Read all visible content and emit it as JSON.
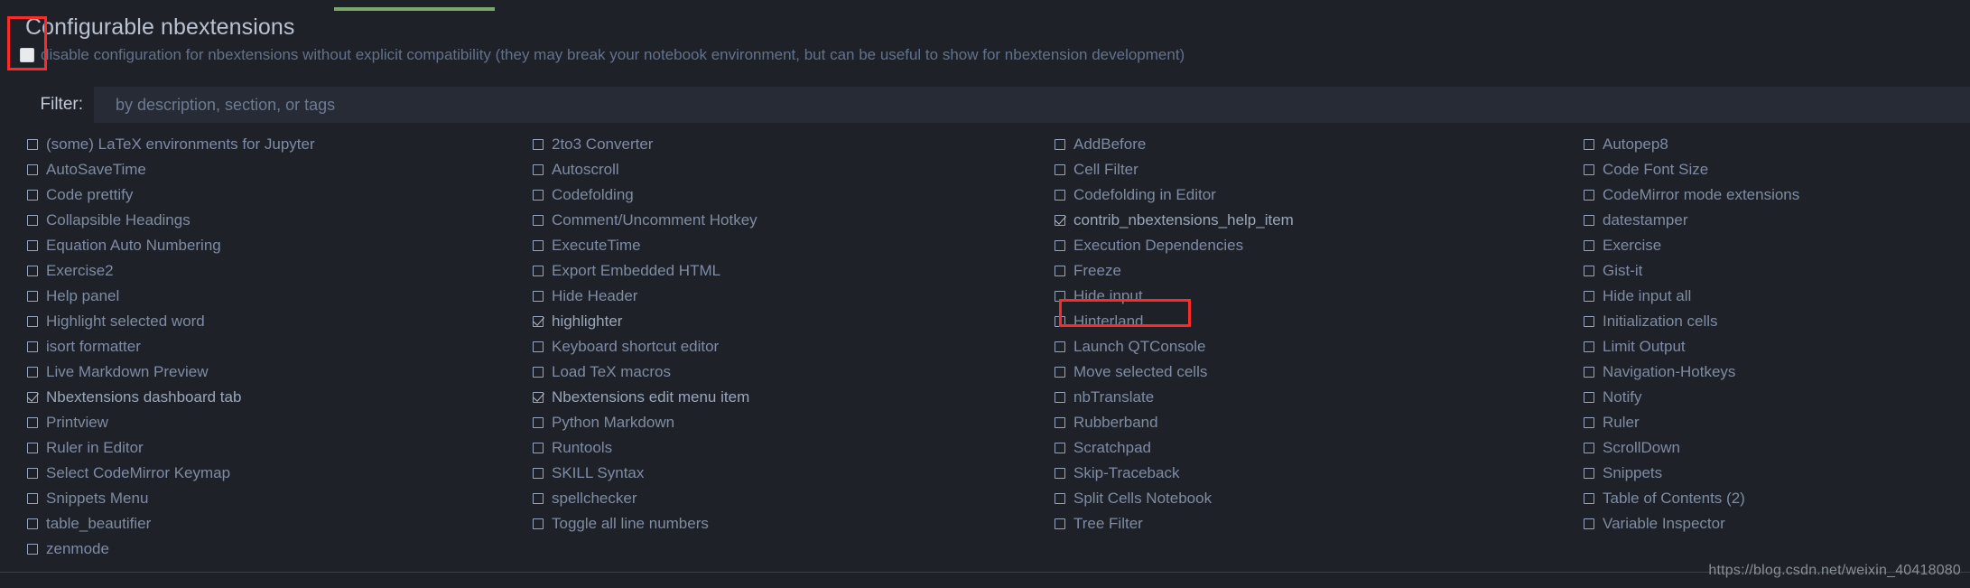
{
  "header": {
    "title": "Configurable nbextensions",
    "disable_label": "disable configuration for nbextensions without explicit compatibility (they may break your notebook environment, but can be useful to show for nbextension development)",
    "disable_checked": true
  },
  "filter": {
    "label": "Filter:",
    "placeholder": "by description, section, or tags",
    "value": ""
  },
  "colors": {
    "accent_green": "#7aa76a",
    "annotation_red": "#fc2b29",
    "background": "#1e2127",
    "input_background": "#262b35",
    "text": "#7f8ca3"
  },
  "annotations": [
    {
      "name": "disable-checkbox-highlight",
      "target": "disable-configuration-checkbox"
    },
    {
      "name": "hinterland-highlight",
      "target": "Hinterland"
    }
  ],
  "extensions": {
    "columns": [
      {
        "items": [
          {
            "label": "(some) LaTeX environments for Jupyter",
            "checked": false
          },
          {
            "label": "AutoSaveTime",
            "checked": false
          },
          {
            "label": "Code prettify",
            "checked": false
          },
          {
            "label": "Collapsible Headings",
            "checked": false
          },
          {
            "label": "Equation Auto Numbering",
            "checked": false
          },
          {
            "label": "Exercise2",
            "checked": false
          },
          {
            "label": "Help panel",
            "checked": false
          },
          {
            "label": "Highlight selected word",
            "checked": false
          },
          {
            "label": "isort formatter",
            "checked": false
          },
          {
            "label": "Live Markdown Preview",
            "checked": false
          },
          {
            "label": "Nbextensions dashboard tab",
            "checked": true
          },
          {
            "label": "Printview",
            "checked": false
          },
          {
            "label": "Ruler in Editor",
            "checked": false
          },
          {
            "label": "Select CodeMirror Keymap",
            "checked": false
          },
          {
            "label": "Snippets Menu",
            "checked": false
          },
          {
            "label": "table_beautifier",
            "checked": false
          },
          {
            "label": "zenmode",
            "checked": false
          }
        ]
      },
      {
        "items": [
          {
            "label": "2to3 Converter",
            "checked": false
          },
          {
            "label": "Autoscroll",
            "checked": false
          },
          {
            "label": "Codefolding",
            "checked": false
          },
          {
            "label": "Comment/Uncomment Hotkey",
            "checked": false
          },
          {
            "label": "ExecuteTime",
            "checked": false
          },
          {
            "label": "Export Embedded HTML",
            "checked": false
          },
          {
            "label": "Hide Header",
            "checked": false
          },
          {
            "label": "highlighter",
            "checked": true
          },
          {
            "label": "Keyboard shortcut editor",
            "checked": false
          },
          {
            "label": "Load TeX macros",
            "checked": false
          },
          {
            "label": "Nbextensions edit menu item",
            "checked": true
          },
          {
            "label": "Python Markdown",
            "checked": false
          },
          {
            "label": "Runtools",
            "checked": false
          },
          {
            "label": "SKILL Syntax",
            "checked": false
          },
          {
            "label": "spellchecker",
            "checked": false
          },
          {
            "label": "Toggle all line numbers",
            "checked": false
          }
        ]
      },
      {
        "items": [
          {
            "label": "AddBefore",
            "checked": false
          },
          {
            "label": "Cell Filter",
            "checked": false
          },
          {
            "label": "Codefolding in Editor",
            "checked": false
          },
          {
            "label": "contrib_nbextensions_help_item",
            "checked": true
          },
          {
            "label": "Execution Dependencies",
            "checked": false
          },
          {
            "label": "Freeze",
            "checked": false
          },
          {
            "label": "Hide input",
            "checked": false
          },
          {
            "label": "Hinterland",
            "checked": false
          },
          {
            "label": "Launch QTConsole",
            "checked": false
          },
          {
            "label": "Move selected cells",
            "checked": false
          },
          {
            "label": "nbTranslate",
            "checked": false
          },
          {
            "label": "Rubberband",
            "checked": false
          },
          {
            "label": "Scratchpad",
            "checked": false
          },
          {
            "label": "Skip-Traceback",
            "checked": false
          },
          {
            "label": "Split Cells Notebook",
            "checked": false
          },
          {
            "label": "Tree Filter",
            "checked": false
          }
        ]
      },
      {
        "items": [
          {
            "label": "Autopep8",
            "checked": false
          },
          {
            "label": "Code Font Size",
            "checked": false
          },
          {
            "label": "CodeMirror mode extensions",
            "checked": false
          },
          {
            "label": "datestamper",
            "checked": false
          },
          {
            "label": "Exercise",
            "checked": false
          },
          {
            "label": "Gist-it",
            "checked": false
          },
          {
            "label": "Hide input all",
            "checked": false
          },
          {
            "label": "Initialization cells",
            "checked": false
          },
          {
            "label": "Limit Output",
            "checked": false
          },
          {
            "label": "Navigation-Hotkeys",
            "checked": false
          },
          {
            "label": "Notify",
            "checked": false
          },
          {
            "label": "Ruler",
            "checked": false
          },
          {
            "label": "ScrollDown",
            "checked": false
          },
          {
            "label": "Snippets",
            "checked": false
          },
          {
            "label": "Table of Contents (2)",
            "checked": false
          },
          {
            "label": "Variable Inspector",
            "checked": false
          }
        ]
      }
    ]
  },
  "footer": {
    "watermark": "https://blog.csdn.net/weixin_40418080"
  }
}
